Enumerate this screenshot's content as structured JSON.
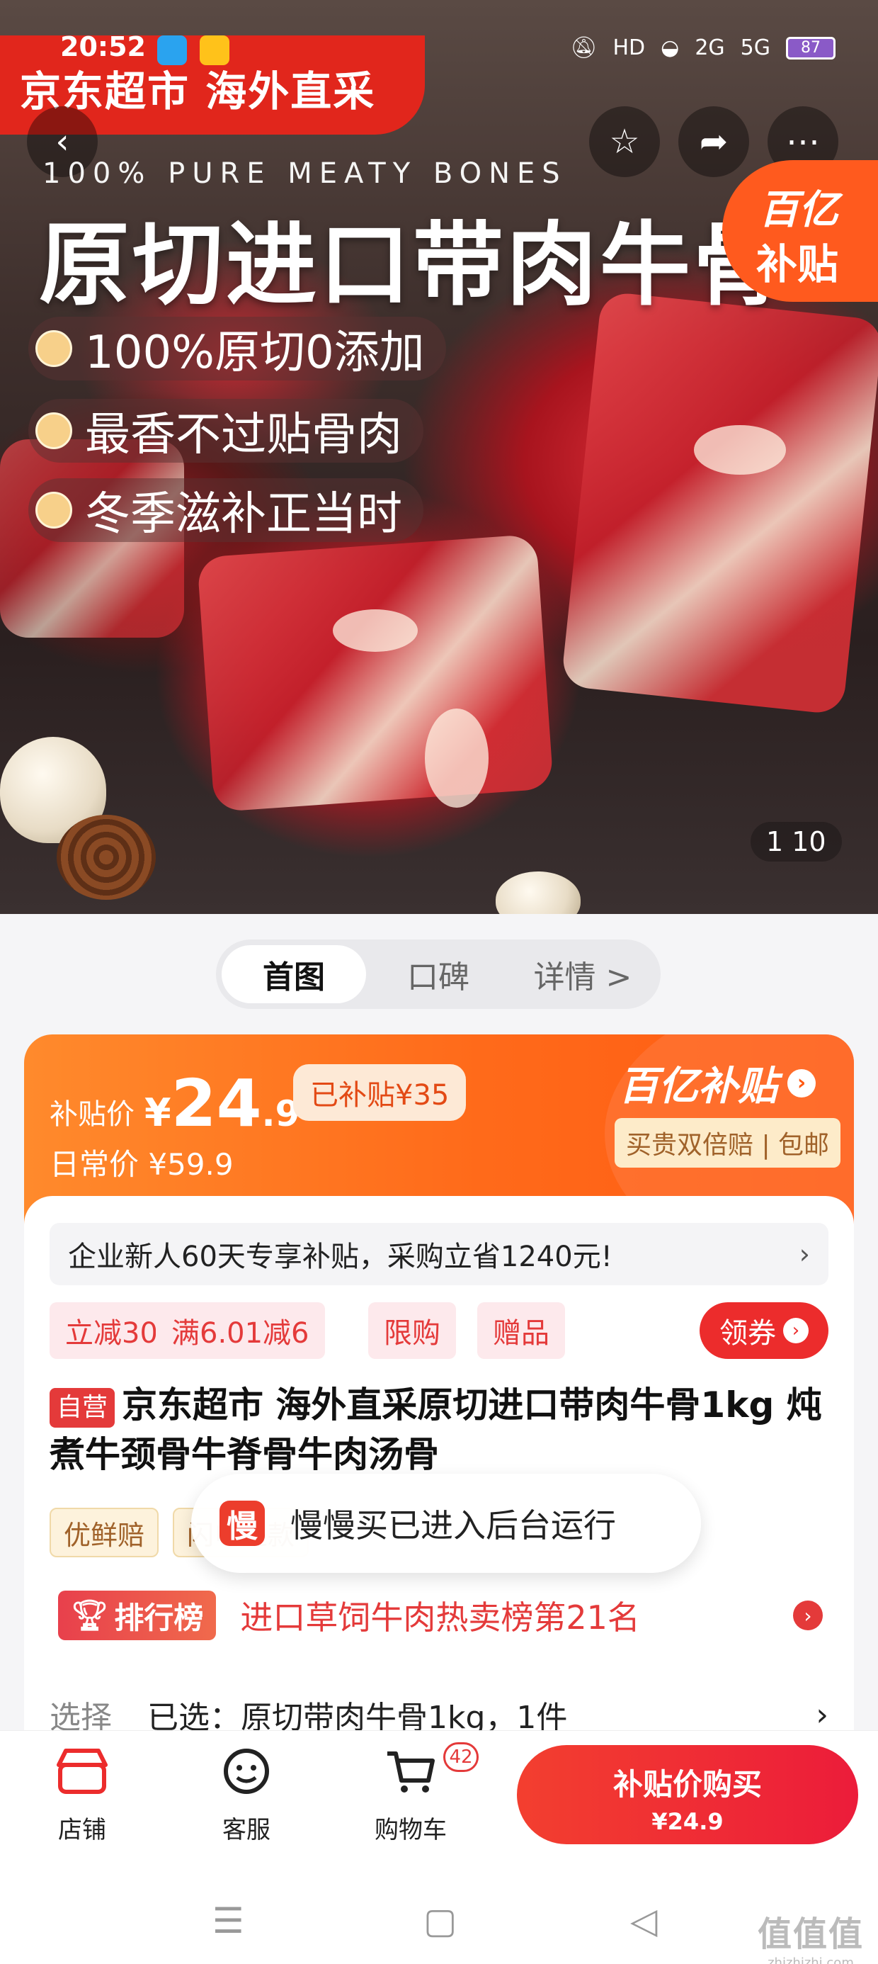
{
  "status_bar": {
    "time": "20:52",
    "hd": "HD",
    "net1": "2G",
    "net2": "5G",
    "battery": "87"
  },
  "hero": {
    "brand_banner": "京东超市 海外直采",
    "subtitle": "100% PURE MEATY BONES",
    "title": "原切进口带肉牛骨",
    "bullets": [
      "100%原切0添加",
      "最香不过贴骨肉",
      "冬季滋补正当时"
    ],
    "subsidy_badge_line1": "百亿",
    "subsidy_badge_line2": "补贴",
    "pager": "1   10"
  },
  "tabs": [
    "首图",
    "口碑",
    "详情 >"
  ],
  "price": {
    "label": "补贴价",
    "currency": "¥",
    "integer": "24",
    "decimal": ".9",
    "subsidized": "已补贴¥35",
    "regular": "日常价 ¥59.9",
    "brand": "百亿补贴",
    "guarantee": "买贵双倍赔 | 包邮"
  },
  "promo_bar": "企业新人60天专享补贴，采购立省1240元!",
  "tags": [
    "立减30",
    "满6.01减6",
    "限购",
    "赠品"
  ],
  "coupon_button": "领券",
  "product": {
    "self_badge": "自营",
    "title": "京东超市 海外直采原切进口带肉牛骨1kg 炖煮牛颈骨牛脊骨牛肉汤骨"
  },
  "service_tags": [
    "优鲜赔",
    "闪电退款"
  ],
  "toast": {
    "icon": "慢",
    "text": "慢慢买已进入后台运行"
  },
  "ranking": {
    "badge": "排行榜",
    "text": "进口草饲牛肉热卖榜第21名"
  },
  "selection": {
    "label": "选择",
    "value": "已选：原切带肉牛骨1kg，1件"
  },
  "bottom_bar": {
    "store": "店铺",
    "service": "客服",
    "cart": "购物车",
    "cart_count": "42",
    "buy_line1": "补贴价购买",
    "buy_line2": "¥24.9"
  },
  "watermark": {
    "main": "值值值",
    "sub": "zhizhizhi.com"
  },
  "colors": {
    "brand_red": "#e1261c",
    "subsidy_orange": "#ff6a1a",
    "accent_red": "#ec2c2c"
  }
}
